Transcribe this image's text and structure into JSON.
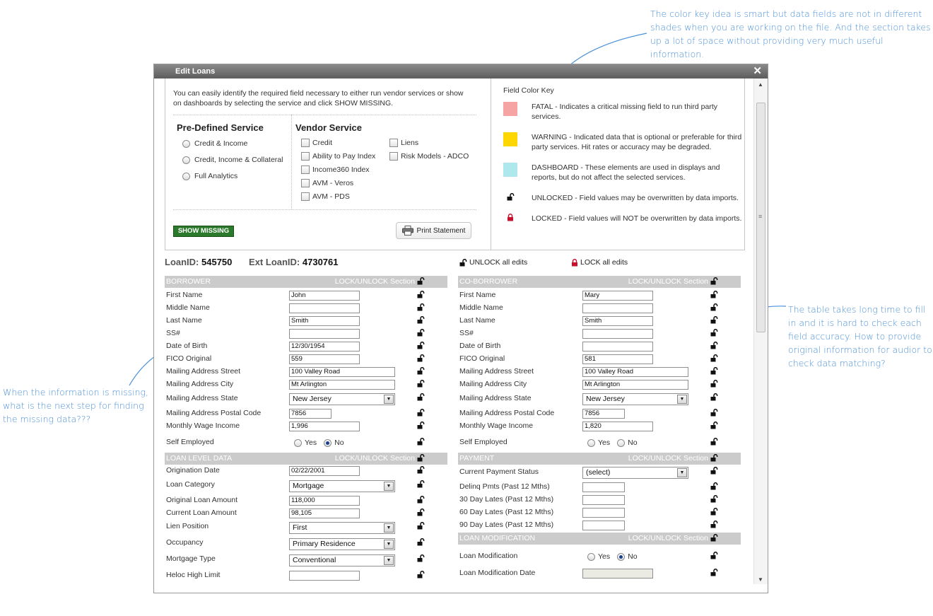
{
  "annotations": {
    "top_right": "The color key idea is smart but data fields are not in different shades when you are working on the file. And the section takes up a lot of space without providing very much useful information.",
    "left": "When the information is missing, what is the next step for finding the missing data???",
    "right": "The table takes long time to fill in and it is hard to check each field accuracy. How to provide original information for audior to check data matching?"
  },
  "dialog": {
    "title": "Edit Loans",
    "close_label": "✕",
    "intro": "You can easily identify the required field necessary to either run vendor services or show on dashboards by selecting the service and click SHOW MISSING.",
    "predefined": {
      "title": "Pre-Defined Service",
      "options": [
        "Credit & Income",
        "Credit, Income & Collateral",
        "Full Analytics"
      ]
    },
    "vendor": {
      "title": "Vendor Service",
      "col1": [
        "Credit",
        "Ability to Pay Index",
        "Income360 Index",
        "AVM - Veros",
        "AVM - PDS"
      ],
      "col2": [
        "Liens",
        "Risk Models - ADCO"
      ]
    },
    "show_missing": "SHOW MISSING",
    "print_statement": "Print Statement",
    "field_color_key": {
      "title": "Field Color Key",
      "items": [
        {
          "color": "#f5a3a3",
          "text": "FATAL - Indicates a critical missing field to run third party services."
        },
        {
          "color": "#ffd700",
          "text": "WARNING - Indicated data that is optional or preferable for third party services. Hit rates or accuracy may be degraded."
        },
        {
          "color": "#aee8ec",
          "text": "DASHBOARD - These elements are used in displays and reports, but do not affect the selected services."
        },
        {
          "icon": "unlocked-icon",
          "text": "UNLOCKED - Field values may be overwritten by data imports."
        },
        {
          "icon": "locked-icon",
          "text": "LOCKED - Field values will NOT be overwritten by data imports."
        }
      ]
    },
    "loan_id_label": "LoanID:",
    "loan_id": "545750",
    "ext_loan_id_label": "Ext LoanID:",
    "ext_loan_id": "4730761",
    "unlock_all": "UNLOCK all edits",
    "lock_all": "LOCK all edits",
    "lock_unlock_section": "LOCK/UNLOCK Section",
    "yes": "Yes",
    "no": "No",
    "borrower": {
      "header": "BORROWER",
      "labels": {
        "first_name": "First Name",
        "middle_name": "Middle Name",
        "last_name": "Last Name",
        "ssn": "SS#",
        "dob": "Date of Birth",
        "fico": "FICO Original",
        "street": "Mailing Address Street",
        "city": "Mailing Address City",
        "state": "Mailing Address State",
        "postal": "Mailing Address Postal Code",
        "income": "Monthly Wage Income",
        "self_employed": "Self Employed"
      },
      "values": {
        "first_name": "John",
        "middle_name": "",
        "last_name": "Smith",
        "ssn": "",
        "dob": "12/30/1954",
        "fico": "559",
        "street": "100 Valley Road",
        "city": "Mt Arlington",
        "state": "New Jersey",
        "postal": "7856",
        "income": "1,996",
        "self_employed": "No"
      }
    },
    "coborrower": {
      "header": "CO-BORROWER",
      "values": {
        "first_name": "Mary",
        "middle_name": "",
        "last_name": "Smith",
        "ssn": "",
        "dob": "",
        "fico": "581",
        "street": "100 Valley Road",
        "city": "Mt Arlington",
        "state": "New Jersey",
        "postal": "7856",
        "income": "1,820",
        "self_employed": "No"
      }
    },
    "loan_level": {
      "header": "LOAN LEVEL DATA",
      "labels": {
        "origination_date": "Origination Date",
        "loan_category": "Loan Category",
        "original_amount": "Original Loan Amount",
        "current_amount": "Current Loan Amount",
        "lien_position": "Lien Position",
        "occupancy": "Occupancy",
        "mortgage_type": "Mortgage Type",
        "heloc": "Heloc High Limit"
      },
      "values": {
        "origination_date": "02/22/2001",
        "loan_category": "Mortgage",
        "original_amount": "118,000",
        "current_amount": "98,105",
        "lien_position": "First",
        "occupancy": "Primary Residence",
        "mortgage_type": "Conventional",
        "heloc": ""
      }
    },
    "payment": {
      "header": "PAYMENT",
      "labels": {
        "status": "Current Payment Status",
        "delinq": "Delinq Pmts (Past 12 Mths)",
        "late30": "30 Day Lates (Past 12 Mths)",
        "late60": "60 Day Lates (Past 12 Mths)",
        "late90": "90 Day Lates (Past 12 Mths)"
      },
      "values": {
        "status": "(select)",
        "delinq": "",
        "late30": "",
        "late60": "",
        "late90": ""
      }
    },
    "loan_mod": {
      "header": "LOAN MODIFICATION",
      "labels": {
        "modification": "Loan Modification",
        "mod_date": "Loan Modification Date"
      },
      "values": {
        "modification": "No",
        "mod_date": ""
      }
    }
  }
}
